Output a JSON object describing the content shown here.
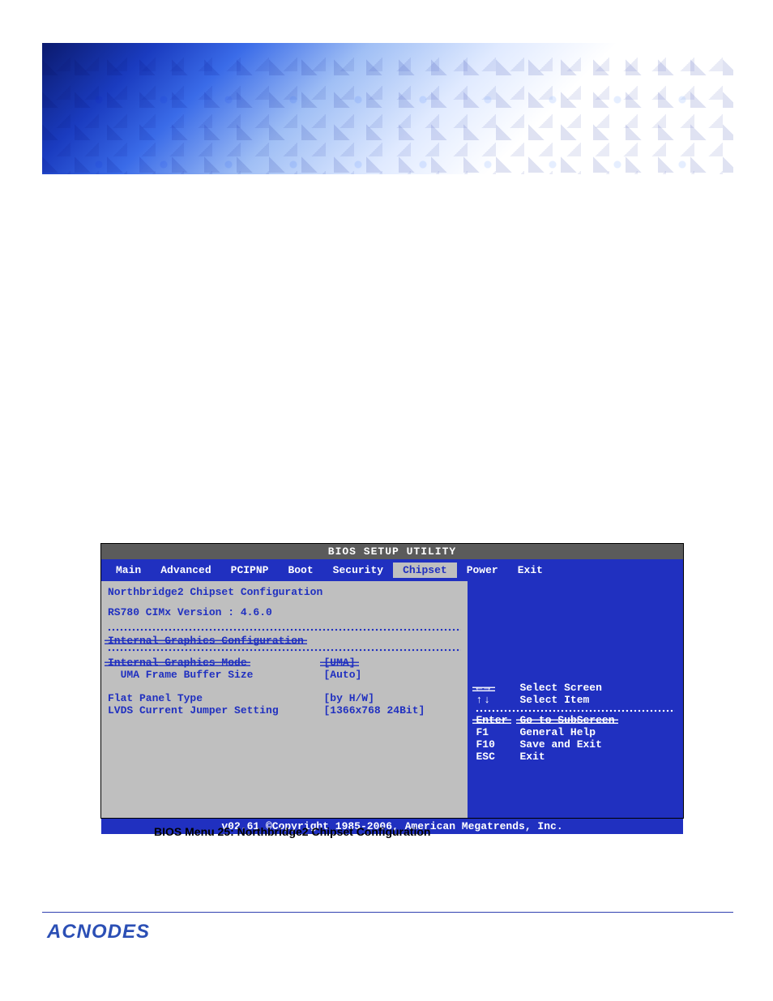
{
  "logo": "ACNODES",
  "caption": "BIOS Menu 25: Northbridge2 Chipset Configuration",
  "bios": {
    "title": "BIOS SETUP UTILITY",
    "menu": [
      "Main",
      "Advanced",
      "PCIPNP",
      "Boot",
      "Security",
      "Chipset",
      "Power",
      "Exit"
    ],
    "active_menu": "Chipset",
    "section_title": "Northbridge2 Chipset Configuration",
    "version_line": "RS780 CIMx Version : 4.6.0",
    "group_header_strike": "Internal Graphics Configuration",
    "rows_strike": [
      {
        "label": "Internal Graphics Mode",
        "value": "[UMA]"
      }
    ],
    "rows": [
      {
        "label": "  UMA Frame Buffer Size",
        "value": "[Auto]"
      },
      {
        "label": "Flat Panel Type",
        "value": "[by H/W]"
      },
      {
        "label": "LVDS Current Jumper Setting",
        "value": "[1366x768 24Bit]"
      }
    ],
    "help_strike": {
      "arrows": "←→",
      "desc": "Select Screen"
    },
    "help_arrows_select_item": {
      "arrows": "↑↓",
      "desc": "Select Item"
    },
    "help_strike2": {
      "key": "Enter",
      "desc": "Go to SubScreen"
    },
    "help": [
      {
        "key": "F1",
        "desc": "General Help"
      },
      {
        "key": "F10",
        "desc": "Save and Exit"
      },
      {
        "key": "ESC",
        "desc": "Exit"
      }
    ],
    "footer": "v02.61 ©Copyright 1985-2006, American Megatrends, Inc."
  }
}
